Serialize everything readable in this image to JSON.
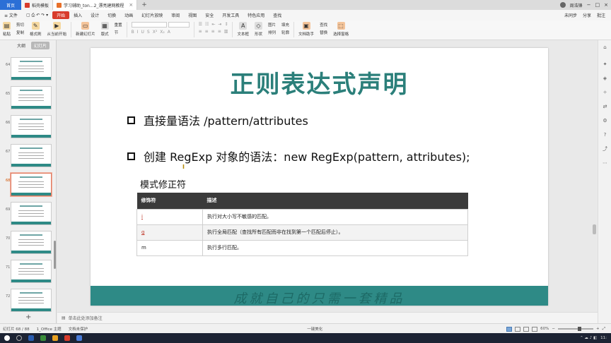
{
  "titlebar": {
    "home_tab": "首页",
    "tabs": [
      {
        "label": "稻壳模板",
        "icon": "docer-icon",
        "color": "#d83b2b"
      },
      {
        "label": "学习辅助_ton...2_漂亮建网教程",
        "icon": "presentation-icon",
        "color": "#e8702a"
      }
    ],
    "user_name": "周浩锋",
    "window_controls": [
      "−",
      "□",
      "×"
    ]
  },
  "menubar": {
    "file": "≡ 文件",
    "items": [
      "开始",
      "插入",
      "设计",
      "切换",
      "动画",
      "幻灯片放映",
      "审阅",
      "视图",
      "安全",
      "开发工具",
      "特色应用",
      "查找"
    ],
    "active": "开始",
    "right": [
      "未同步",
      "分享",
      "批注"
    ]
  },
  "ribbon": {
    "buttons": [
      {
        "label": "粘贴",
        "icon": "paste-icon",
        "color": "#e0a030"
      },
      {
        "label": "剪切",
        "icon": "cut-icon",
        "color": "#888888"
      },
      {
        "label": "复制",
        "icon": "copy-icon",
        "color": "#888888"
      },
      {
        "label": "格式刷",
        "icon": "format-painter-icon",
        "color": "#e0a030"
      },
      {
        "label": "从当前开始",
        "icon": "play-icon",
        "color": "#e0a030"
      },
      {
        "label": "新建幻灯片",
        "icon": "new-slide-icon",
        "color": "#e07a2a"
      },
      {
        "label": "版式",
        "icon": "layout-icon",
        "color": "#888888"
      },
      {
        "label": "节",
        "icon": "section-icon",
        "color": "#888888"
      },
      {
        "label": "重置",
        "icon": "reset-icon",
        "color": "#888888"
      }
    ],
    "right_buttons": [
      {
        "label": "文本框",
        "icon": "textbox-icon"
      },
      {
        "label": "形状",
        "icon": "shape-icon"
      },
      {
        "label": "排列",
        "icon": "arrange-icon"
      },
      {
        "label": "图片",
        "icon": "picture-icon"
      },
      {
        "label": "填充",
        "icon": "fill-icon"
      },
      {
        "label": "轮廓",
        "icon": "outline-icon"
      },
      {
        "label": "文档助手",
        "icon": "doc-assistant-icon"
      },
      {
        "label": "查找",
        "icon": "find-icon"
      },
      {
        "label": "替换",
        "icon": "replace-icon"
      },
      {
        "label": "选择窗格",
        "icon": "selection-pane-icon"
      }
    ]
  },
  "leftpane": {
    "tabs": [
      "大纲",
      "幻灯片"
    ],
    "active_tab": "幻灯片",
    "slides": [
      {
        "num": "64"
      },
      {
        "num": "65"
      },
      {
        "num": "66"
      },
      {
        "num": "67"
      },
      {
        "num": "68",
        "selected": true
      },
      {
        "num": "69"
      },
      {
        "num": "70"
      },
      {
        "num": "71"
      },
      {
        "num": "72"
      }
    ],
    "add_label": "+"
  },
  "slide": {
    "title": "正则表达式声明",
    "bullets": [
      "直接量语法 /pattern/attributes",
      "创建 RegExp 对象的语法：new RegExp(pattern, attributes);"
    ],
    "sub_heading": "模式修正符",
    "table": {
      "headers": [
        "修饰符",
        "描述"
      ],
      "rows": [
        {
          "modifier": "i",
          "desc": "执行对大小写不敏感的匹配。",
          "link": true
        },
        {
          "modifier": "g",
          "desc": "执行全局匹配（查找所有匹配而非在找到第一个匹配后停止）。",
          "link": true
        },
        {
          "modifier": "m",
          "desc": "执行多行匹配。",
          "link": false
        }
      ]
    },
    "footer_text": "成就自己的只需一套精品",
    "footer_color": "#2e8a86",
    "title_color": "#2b7f7a"
  },
  "notes": {
    "placeholder": "单击此处添加备注"
  },
  "statusbar": {
    "slide_info": "幻灯片 68 / 88",
    "theme": "1_Office 主题",
    "protection": "文档未保护",
    "beautify": "一键美化",
    "zoom": "60%"
  },
  "taskbar": {
    "time": "11:"
  }
}
